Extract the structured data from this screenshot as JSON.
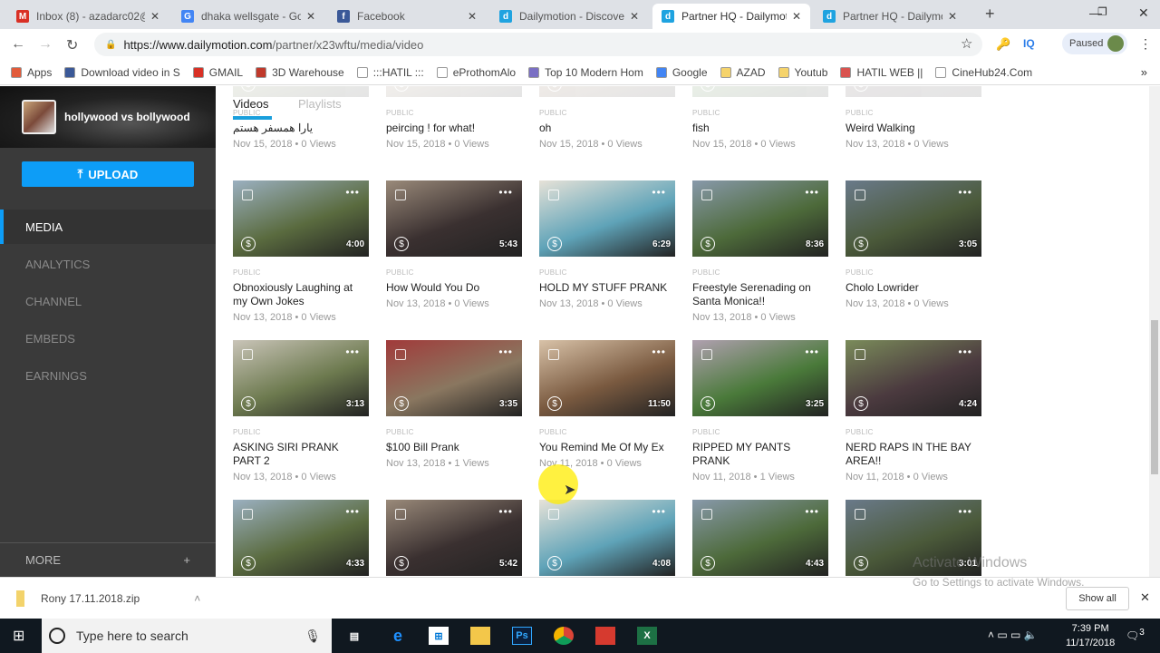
{
  "browser": {
    "tabs": [
      {
        "label": "Inbox (8) - azadarc02@",
        "icon": "gmail-icon",
        "color": "#d93025"
      },
      {
        "label": "dhaka wellsgate - Goog",
        "icon": "google-icon",
        "color": "#4285f4"
      },
      {
        "label": "Facebook",
        "icon": "facebook-icon",
        "color": "#3b5998"
      },
      {
        "label": "Dailymotion - Discover",
        "icon": "dailymotion-icon",
        "color": "#1fa3e0"
      },
      {
        "label": "Partner HQ - Dailymotion",
        "icon": "dailymotion-icon",
        "color": "#1fa3e0",
        "active": true
      },
      {
        "label": "Partner HQ - Dailymotion",
        "icon": "dailymotion-icon",
        "color": "#1fa3e0"
      }
    ],
    "url_host": "https://www.dailymotion.com",
    "url_path": "/partner/x23wftu/media/video",
    "profile_status": "Paused",
    "ext_iq": "IQ",
    "bookmarks": [
      {
        "label": "Apps",
        "color": "#e25b3a"
      },
      {
        "label": "Download video in S",
        "color": "#3b5998"
      },
      {
        "label": "GMAIL",
        "color": "#d93025"
      },
      {
        "label": "3D Warehouse",
        "color": "#c0392b"
      },
      {
        "label": ":::HATIL :::",
        "color": "#fff"
      },
      {
        "label": "eProthomAlo",
        "color": "#fff"
      },
      {
        "label": "Top 10 Modern Hom",
        "color": "#7a6fc4"
      },
      {
        "label": "Google",
        "color": "#4285f4"
      },
      {
        "label": "AZAD",
        "color": "#f5d36b"
      },
      {
        "label": "Youtub",
        "color": "#f5d36b"
      },
      {
        "label": "HATIL WEB ||",
        "color": "#d9534f"
      },
      {
        "label": "CineHub24.Com",
        "color": "#fff"
      }
    ]
  },
  "sidebar": {
    "channel_name": "hollywood vs bollywood",
    "upload_label": "UPLOAD",
    "items": [
      {
        "label": "MEDIA",
        "active": true
      },
      {
        "label": "ANALYTICS"
      },
      {
        "label": "CHANNEL"
      },
      {
        "label": "EMBEDS"
      },
      {
        "label": "EARNINGS"
      }
    ],
    "more_label": "MORE",
    "more_icon": "+"
  },
  "main": {
    "tabs": [
      {
        "label": "Videos",
        "active": true
      },
      {
        "label": "Playlists"
      }
    ],
    "accent": "#1a9fdc",
    "videos": [
      {
        "title": "یارا همسفر هستم",
        "visibility": "PUBLIC",
        "meta": "Nov 15, 2018 • 0 Views",
        "duration": ""
      },
      {
        "title": "peircing ! for what!",
        "visibility": "PUBLIC",
        "meta": "Nov 15, 2018 • 0 Views",
        "duration": ""
      },
      {
        "title": "oh",
        "visibility": "PUBLIC",
        "meta": "Nov 15, 2018 • 0 Views",
        "duration": ""
      },
      {
        "title": "fish",
        "visibility": "PUBLIC",
        "meta": "Nov 15, 2018 • 0 Views",
        "duration": ""
      },
      {
        "title": "Weird Walking",
        "visibility": "PUBLIC",
        "meta": "Nov 13, 2018 • 0 Views",
        "duration": ""
      },
      {
        "title": "Obnoxiously Laughing at my Own Jokes",
        "visibility": "PUBLIC",
        "meta": "Nov 13, 2018 • 0 Views",
        "duration": "4:00"
      },
      {
        "title": "How Would You Do",
        "visibility": "PUBLIC",
        "meta": "Nov 13, 2018 • 0 Views",
        "duration": "5:43"
      },
      {
        "title": "HOLD MY STUFF PRANK",
        "visibility": "PUBLIC",
        "meta": "Nov 13, 2018 • 0 Views",
        "duration": "6:29"
      },
      {
        "title": "Freestyle Serenading on Santa Monica!!",
        "visibility": "PUBLIC",
        "meta": "Nov 13, 2018 • 0 Views",
        "duration": "8:36"
      },
      {
        "title": "Cholo Lowrider",
        "visibility": "PUBLIC",
        "meta": "Nov 13, 2018 • 0 Views",
        "duration": "3:05"
      },
      {
        "title": "ASKING SIRI PRANK PART 2",
        "visibility": "PUBLIC",
        "meta": "Nov 13, 2018 • 0 Views",
        "duration": "3:13"
      },
      {
        "title": "$100 Bill Prank",
        "visibility": "PUBLIC",
        "meta": "Nov 13, 2018 • 1 Views",
        "duration": "3:35"
      },
      {
        "title": "You Remind Me Of My Ex",
        "visibility": "PUBLIC",
        "meta": "Nov 11, 2018 • 0 Views",
        "duration": "11:50"
      },
      {
        "title": "RIPPED MY PANTS PRANK",
        "visibility": "PUBLIC",
        "meta": "Nov 11, 2018 • 1 Views",
        "duration": "3:25"
      },
      {
        "title": "NERD RAPS IN THE BAY AREA!!",
        "visibility": "PUBLIC",
        "meta": "Nov 11, 2018 • 0 Views",
        "duration": "4:24"
      },
      {
        "title": "",
        "visibility": "",
        "meta": "",
        "duration": "4:33"
      },
      {
        "title": "",
        "visibility": "",
        "meta": "",
        "duration": "5:42"
      },
      {
        "title": "",
        "visibility": "",
        "meta": "",
        "duration": "4:08"
      },
      {
        "title": "",
        "visibility": "",
        "meta": "",
        "duration": "4:43"
      },
      {
        "title": "",
        "visibility": "",
        "meta": "",
        "duration": "3:01"
      }
    ]
  },
  "download_bar": {
    "file": "Rony 17.11.2018.zip",
    "show_all": "Show all"
  },
  "watermark": {
    "line1": "Activate Windows",
    "line2": "Go to Settings to activate Windows."
  },
  "taskbar": {
    "search_placeholder": "Type here to search",
    "time": "7:39 PM",
    "date": "11/17/2018",
    "notifications": "3"
  }
}
